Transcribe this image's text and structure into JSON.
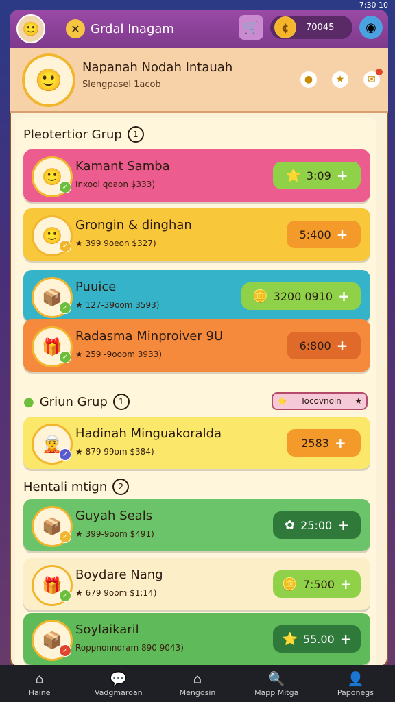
{
  "status_bar": {
    "time": "7:30 10"
  },
  "topbar": {
    "title": "Grdal Inagam",
    "coins": "70045",
    "icons": {
      "avatar": "avatar-icon",
      "close": "close-icon",
      "shop": "shop-icon",
      "coin": "coin-icon",
      "character": "blue-character-icon"
    }
  },
  "profile": {
    "name": "Napanah Nodah Intauah",
    "subtitle": "Slengpasel 1acob",
    "icons": [
      "coin-icon",
      "star-icon",
      "notification-icon"
    ]
  },
  "sections": [
    {
      "title": "Pleotertior Grup",
      "count": "1"
    },
    {
      "title": "Griun Grup",
      "count": "1",
      "tag": "Tocovnoin"
    },
    {
      "title": "Hentali mtign",
      "count": "2"
    }
  ],
  "cards": [
    {
      "name": "Kamant Samba",
      "sub": "Inxool qoaon $333)",
      "price": "3:09",
      "price_icon": "star-icon",
      "bg": "#ec5c8f",
      "btn": "#8fd24a"
    },
    {
      "name": "Grongin & dinghan",
      "sub": "★ 399 9oeon $327)",
      "price": "5:400",
      "price_icon": "",
      "bg": "#f8c73a",
      "btn": "#f39a2a"
    },
    {
      "name": "Puuice",
      "sub": "★ 127-39oom 3593)",
      "price": "3200 0910",
      "price_icon": "coin-icon",
      "bg": "#35b3c9",
      "btn": "#8fd24a"
    },
    {
      "name": "Radasma Minproiver 9U",
      "sub": "★ 259 -9ooom 3933)",
      "price": "6:800",
      "price_icon": "",
      "bg": "#f58a3c",
      "btn": "#e06a2a"
    },
    {
      "name": "Hadinah Minguakoralda",
      "sub": "★ 879 99om $384)",
      "price": "2583",
      "price_icon": "",
      "bg": "#fbe86a",
      "btn": "#f39a2a"
    },
    {
      "name": "Guyah Seals",
      "sub": "★ 399-9oom $491)",
      "price": "25:00",
      "price_icon": "paw-icon",
      "bg": "#6cc46a",
      "btn": "#2f7a3a"
    },
    {
      "name": "Boydare Nang",
      "sub": "★ 679 9oom $1:14)",
      "price": "7:500",
      "price_icon": "coin-icon",
      "bg": "#fcefc7",
      "btn": "#8fd24a"
    },
    {
      "name": "Soylaikaril",
      "sub": "Roppnonndram 890 9043)",
      "price": "55.00",
      "price_icon": "star-icon",
      "bg": "#5fbb5a",
      "btn": "#2f7a3a"
    }
  ],
  "nav": [
    {
      "label": "Haine",
      "icon": "home-icon"
    },
    {
      "label": "Vadgmaroan",
      "icon": "chat-icon"
    },
    {
      "label": "Mengosin",
      "icon": "house-icon"
    },
    {
      "label": "Mapp Mitga",
      "icon": "search-icon"
    },
    {
      "label": "Paponegs",
      "icon": "profile-icon"
    }
  ]
}
